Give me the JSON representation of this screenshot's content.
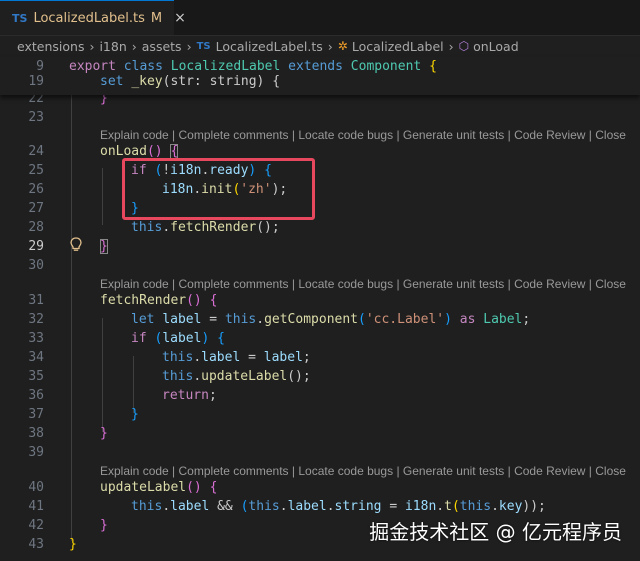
{
  "tab": {
    "lang_badge": "TS",
    "filename": "LocalizedLabel.ts",
    "status": "M",
    "close": "×"
  },
  "breadcrumb": {
    "items": [
      "extensions",
      "i18n",
      "assets",
      "LocalizedLabel.ts",
      "LocalizedLabel",
      "onLoad"
    ],
    "file_badge": "TS"
  },
  "codelens": {
    "items": [
      "Explain code",
      "Complete comments",
      "Locate code bugs",
      "Generate unit tests",
      "Code Review",
      "Close"
    ]
  },
  "sticky": {
    "line9": {
      "number": "9",
      "t1": "export",
      "t2": "class",
      "t3": "LocalizedLabel",
      "t4": "extends",
      "t5": "Component",
      "t6": "{"
    },
    "line19": {
      "number": "19",
      "t1": "set",
      "t2": "_key",
      "t3": "(str: string) {"
    }
  },
  "lines": {
    "l22": {
      "number": "22",
      "brace": "}"
    },
    "l23": {
      "number": "23"
    },
    "l24": {
      "number": "24",
      "fn": "onLoad",
      "parens": "()",
      "brace": "{"
    },
    "l25": {
      "number": "25",
      "kw": "if",
      "open": "(",
      "neg": "!",
      "obj": "i18n",
      "dot": ".",
      "prop": "ready",
      "close": ")",
      "brace": "{"
    },
    "l26": {
      "number": "26",
      "obj": "i18n",
      "dot": ".",
      "fn": "init",
      "open": "(",
      "str": "'zh'",
      "close": ");"
    },
    "l27": {
      "number": "27",
      "brace": "}"
    },
    "l28": {
      "number": "28",
      "this": "this",
      "dot": ".",
      "fn": "fetchRender",
      "rest": "();"
    },
    "l29": {
      "number": "29",
      "brace": "}"
    },
    "l30": {
      "number": "30"
    },
    "l31": {
      "number": "31",
      "fn": "fetchRender",
      "parens": "()",
      "brace": "{"
    },
    "l32": {
      "number": "32",
      "kw": "let",
      "var": "label",
      "eq": " = ",
      "this": "this",
      "dot": ".",
      "fn": "getComponent",
      "open": "(",
      "str": "'cc.Label'",
      "close": ")",
      "as": "as",
      "type": "Label",
      "semi": ";"
    },
    "l33": {
      "number": "33",
      "kw": "if",
      "open": "(",
      "var": "label",
      "close": ")",
      "brace": "{"
    },
    "l34": {
      "number": "34",
      "this": "this",
      "dot": ".",
      "prop": "label",
      "eq": " = ",
      "var": "label",
      "semi": ";"
    },
    "l35": {
      "number": "35",
      "this": "this",
      "dot": ".",
      "fn": "updateLabel",
      "rest": "();"
    },
    "l36": {
      "number": "36",
      "kw": "return",
      "semi": ";"
    },
    "l37": {
      "number": "37",
      "brace": "}"
    },
    "l38": {
      "number": "38",
      "brace": "}"
    },
    "l39": {
      "number": "39"
    },
    "l40": {
      "number": "40",
      "fn": "updateLabel",
      "parens": "()",
      "brace": "{"
    },
    "l41": {
      "number": "41",
      "this1": "this",
      "dot1": ".",
      "prop1": "label",
      "amp": " && ",
      "open": "(",
      "this2": "this",
      "dot2": ".",
      "prop2": "label",
      "dot3": ".",
      "prop3": "string",
      "eq": " = ",
      "obj": "i18n",
      "dot4": ".",
      "fn": "t",
      "open2": "(",
      "this3": "this",
      "dot5": ".",
      "prop4": "key",
      "close": "));"
    },
    "l42": {
      "number": "42",
      "brace": "}"
    },
    "l43": {
      "number": "43",
      "brace": "}"
    }
  },
  "watermark": "掘金技术社区 @ 亿元程序员",
  "colors": {
    "keyword": "#569cd6",
    "control": "#c586c0",
    "function": "#dcdcaa",
    "type": "#4ec9b0",
    "variable": "#9cdcfe",
    "string": "#ce9178",
    "highlight_border": "#e8485e",
    "modified": "#e2c08d"
  }
}
